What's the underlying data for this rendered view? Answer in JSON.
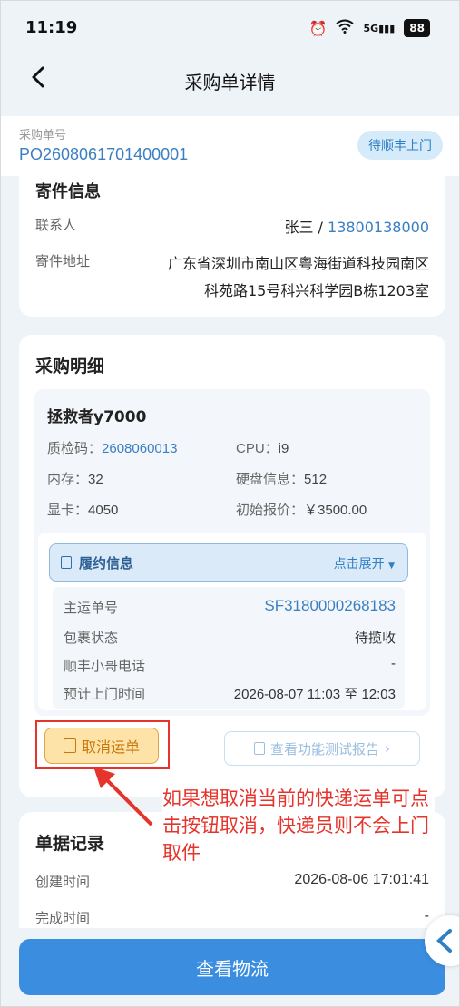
{
  "status_bar": {
    "time": "11:19",
    "battery": "88",
    "network": "5G"
  },
  "nav": {
    "title": "采购单详情"
  },
  "order": {
    "label": "采购单号",
    "number": "PO2608061701400001",
    "status": "待顺丰上门"
  },
  "sender": {
    "title": "寄件信息",
    "contact_label": "联系人",
    "contact_name": "张三 / ",
    "contact_phone": "13800138000",
    "address_label": "寄件地址",
    "address_line1": "广东省深圳市南山区粤海街道科技园南区",
    "address_line2": "科苑路15号科兴科学园B栋1203室"
  },
  "purchase": {
    "title": "采购明细",
    "product_name": "拯救者y7000",
    "specs": {
      "qc_label": "质检码：",
      "qc_value": "2608060013",
      "cpu_label": "CPU：",
      "cpu_value": "i9",
      "ram_label": "内存：",
      "ram_value": "32",
      "disk_label": "硬盘信息：",
      "disk_value": "512",
      "gpu_label": "显卡：",
      "gpu_value": "4050",
      "price_label": "初始报价：",
      "price_value": "￥3500.00"
    },
    "fulfilment": {
      "title": "履约信息",
      "expand": "点击展开",
      "rows": [
        {
          "label": "主运单号",
          "value": "SF3180000268183"
        },
        {
          "label": "包裹状态",
          "value": "待揽收"
        },
        {
          "label": "顺丰小哥电话",
          "value": "-"
        },
        {
          "label": "预计上门时间",
          "value": "2026-08-07 11:03 至 12:03"
        }
      ]
    },
    "cancel_button": "取消运单",
    "report_button": "查看功能测试报告"
  },
  "annotation": {
    "text": "如果想取消当前的快递运单可点击按钮取消，快递员则不会上门取件",
    "color": "#e5342c"
  },
  "records": {
    "title": "单据记录",
    "created_label": "创建时间",
    "created_value": "2026-08-06 17:01:41",
    "finished_label": "完成时间",
    "finished_value": "-"
  },
  "bottom": {
    "logistics_button": "查看物流"
  },
  "colors": {
    "accent": "#3b8de0",
    "link": "#3a7fc2",
    "warning": "#c9760b"
  }
}
